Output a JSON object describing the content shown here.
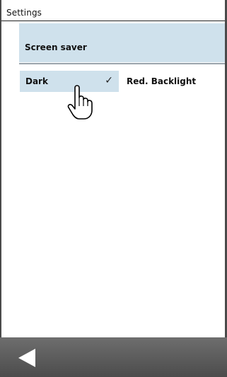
{
  "header": {
    "title": "Settings"
  },
  "section": {
    "label": "Screen saver"
  },
  "options": [
    {
      "label": "Dark",
      "check_icon": "✓",
      "selected": true
    },
    {
      "label": "Red. Backlight",
      "selected": false
    }
  ],
  "footer": {
    "back_icon": "back-arrow-icon"
  },
  "colors": {
    "accent_bg": "#cfe1ec",
    "bottom_bar": "#5a5a5a"
  }
}
